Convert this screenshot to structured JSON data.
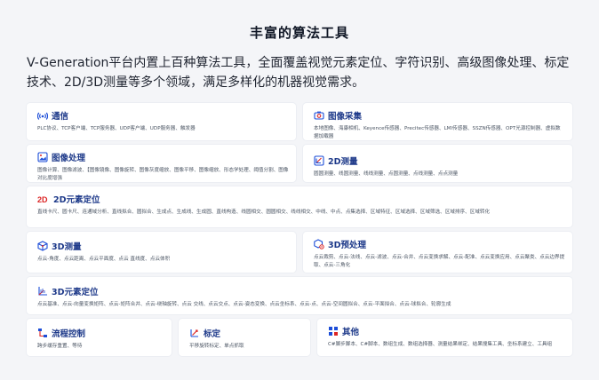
{
  "page": {
    "title": "丰富的算法工具",
    "intro": "V-Generation平台内置上百种算法工具，全面覆盖视觉元素定位、字符识别、高级图像处理、标定技术、2D/3D测量等多个领域，满足多样化的机器视觉需求。"
  },
  "cards": {
    "communication": {
      "icon": "signal-icon",
      "title": "通信",
      "body": "PLC协议、TCP客户端、TCP服务器、UDP客户端、UDP服务器、触发器"
    },
    "acquisition": {
      "icon": "camera-icon",
      "title": "图像采集",
      "body": "本地图像、海康相机、Keyence传感器、Precitec传感器、LMI传感器、SSZN传感器、OPT光源控制器、虚拟数据加载器"
    },
    "processing": {
      "icon": "image-icon",
      "title": "图像处理",
      "body": "图像计算、图像滤波、【图像镜像、图像旋转、图像灰度缩放、图像平移、图像缩放、形态学处理、阈值分割、图像对比度增强"
    },
    "measure2d": {
      "icon": "2d-icon",
      "title": "2D测量",
      "body": "圆圆测量、线圆测量、线线测量、点圆测量、点线测量、点点测量"
    },
    "locate2d": {
      "icon": "2d-badge-icon",
      "badge": "2D",
      "title": "2D元素定位",
      "body": "直线卡尺、圆卡尺、连通域分析、直线拟合、圆拟合、生成点、生成线、生成圆、直线构造、线圆相交、圆圆相交、线线相交、中线、中点、点集选择、区域特征、区域选择、区域筛选、区域排序、区域转化"
    },
    "measure3d": {
      "icon": "cube-icon",
      "title": "3D测量",
      "body": "点云-角度、点云距离、点云平面度、点云 直线度、点云体积"
    },
    "preprocess3d": {
      "icon": "cube-gear-icon",
      "title": "3D预处理",
      "body": "点云裁剪、点云-法线、点云-滤波、点云-合并、点云变换求解、点云-配准、点云变换应用、点云聚类、点云边界提取、点云-三角化"
    },
    "locate3d": {
      "icon": "axis-3d-icon",
      "title": "3D元素定位",
      "body": "点云基准、点云-向量变换矩阵、点云-矩阵合并、点云-绕轴旋转、点云 交线、点云交点、点云-姿态变换、点云坐标系、点云-点、点云-空间圆拟合、点云-平面拟合、点云-球拟合、轮廓生成"
    },
    "flow": {
      "icon": "flow-icon",
      "title": "流程控制",
      "body": "跨步缓存重置、等待"
    },
    "calibration": {
      "icon": "calibration-icon",
      "title": "标定",
      "body": "平移旋转标定、单点抓取"
    },
    "other": {
      "icon": "grid-icon",
      "title": "其他",
      "body": "C#脚步脚本、C#脚本、数组生成、数组选择器、测量结果绑定、结果搜集工具、坐标系建立、工具组"
    }
  },
  "colors": {
    "accent": "#1d4ed8",
    "accent_red": "#dc2626",
    "card_title": "#1e3a8a",
    "background": "#f4f5f8"
  }
}
